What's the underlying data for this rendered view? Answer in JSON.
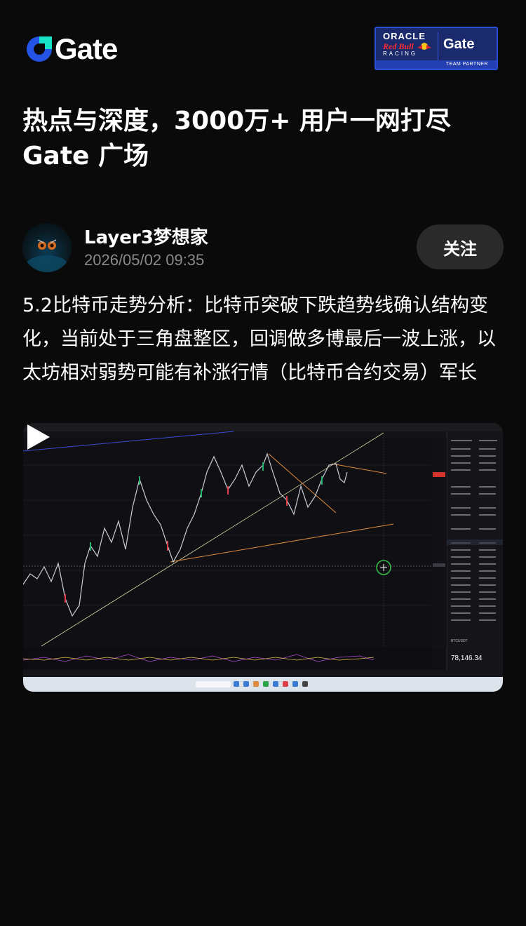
{
  "brand": {
    "name": "Gate",
    "accent": "#2354e6",
    "accent_teal": "#17e3c6"
  },
  "partner": {
    "oracle": "ORACLE",
    "redbull": "Red Bull",
    "racing": "RACING",
    "gate": "Gate",
    "team": "TEAM PARTNER"
  },
  "headline": {
    "line1": "热点与深度，3000万+ 用户一网打尽",
    "line2": "Gate 广场"
  },
  "author": {
    "name": "Layer3梦想家",
    "time": "2026/05/02 09:35",
    "follow_label": "关注"
  },
  "post": {
    "text": "5.2比特币走势分析：比特币突破下跌趋势线确认结构变化，当前处于三角盘整区，回调做多博最后一波上涨，以太坊相对弱势可能有补涨行情（比特币合约交易）军长"
  },
  "video": {
    "play_icon": "play-icon",
    "price_label": "78,146.34",
    "price_unit": "USDT",
    "symbol": "BTCUSDT"
  }
}
